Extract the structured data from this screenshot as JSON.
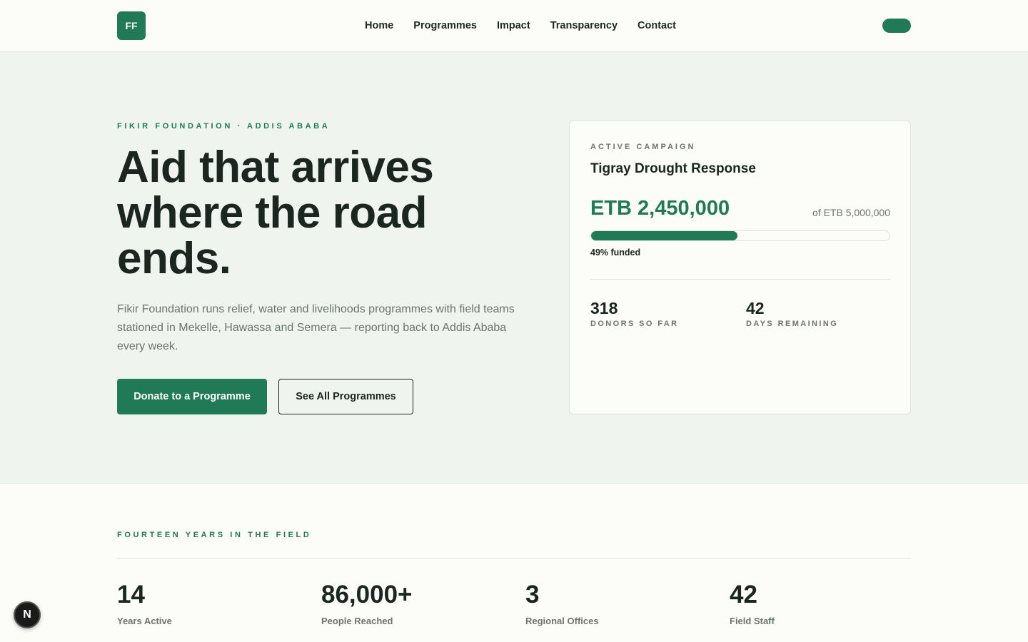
{
  "header": {
    "logo_text": "FF",
    "nav": [
      "Home",
      "Programmes",
      "Impact",
      "Transparency",
      "Contact"
    ],
    "cta_label": ""
  },
  "hero": {
    "eyebrow": "FIKIR FOUNDATION · ADDIS ABABA",
    "headline_lines": [
      "Aid that arrives",
      "where the road",
      "ends."
    ],
    "lead": "Fikir Foundation runs relief, water and livelihoods programmes with field teams stationed in Mekelle, Hawassa and Semera — reporting back to Addis Ababa every week.",
    "primary_button": "Donate to a Programme",
    "secondary_button": "See All Programmes"
  },
  "campaign": {
    "eyebrow": "ACTIVE CAMPAIGN",
    "title": "Tigray Drought Response",
    "raised": "ETB 2,450,000",
    "goal": "of ETB 5,000,000",
    "progress_percent": 49,
    "funded_label": "49% funded",
    "stats": [
      {
        "value": "318",
        "label": "DONORS SO FAR"
      },
      {
        "value": "42",
        "label": "DAYS REMAINING"
      }
    ]
  },
  "history": {
    "eyebrow": "FOURTEEN YEARS IN THE FIELD",
    "stats": [
      {
        "value": "14",
        "label": "Years Active"
      },
      {
        "value": "86,000+",
        "label": "People Reached"
      },
      {
        "value": "3",
        "label": "Regional Offices"
      },
      {
        "value": "42",
        "label": "Field Staff"
      }
    ]
  },
  "dev_badge": "N",
  "colors": {
    "brand": "#1f7a55",
    "hero_bg": "#eff4ef",
    "text": "#1a261f",
    "muted": "#6b756f"
  }
}
